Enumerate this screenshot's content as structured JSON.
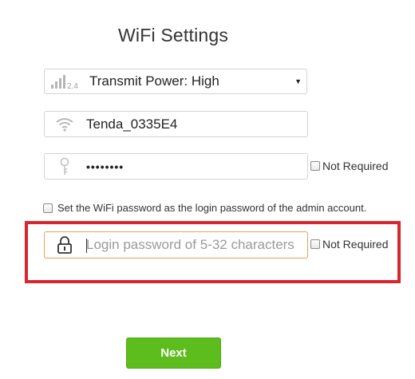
{
  "page": {
    "title": "WiFi Settings"
  },
  "transmit_power": {
    "band_label": "2.4",
    "selected": "Transmit Power: High",
    "icon": "signal-bars-icon"
  },
  "ssid": {
    "value": "Tenda_0335E4",
    "icon": "wifi-icon"
  },
  "wifi_password": {
    "value": "••••••••",
    "icon": "key-icon",
    "not_required_label": "Not Required",
    "not_required_checked": false
  },
  "admin_option": {
    "label": "Set the WiFi password as the login password of the admin account.",
    "checked": false
  },
  "login_password": {
    "placeholder": "Login password of 5-32 characters",
    "icon": "lock-icon",
    "not_required_label": "Not Required",
    "not_required_checked": false
  },
  "actions": {
    "next_label": "Next"
  },
  "colors": {
    "highlight_border": "#d9262c",
    "next_button": "#5cbd1d",
    "focused_input_border": "#e6a25c"
  }
}
